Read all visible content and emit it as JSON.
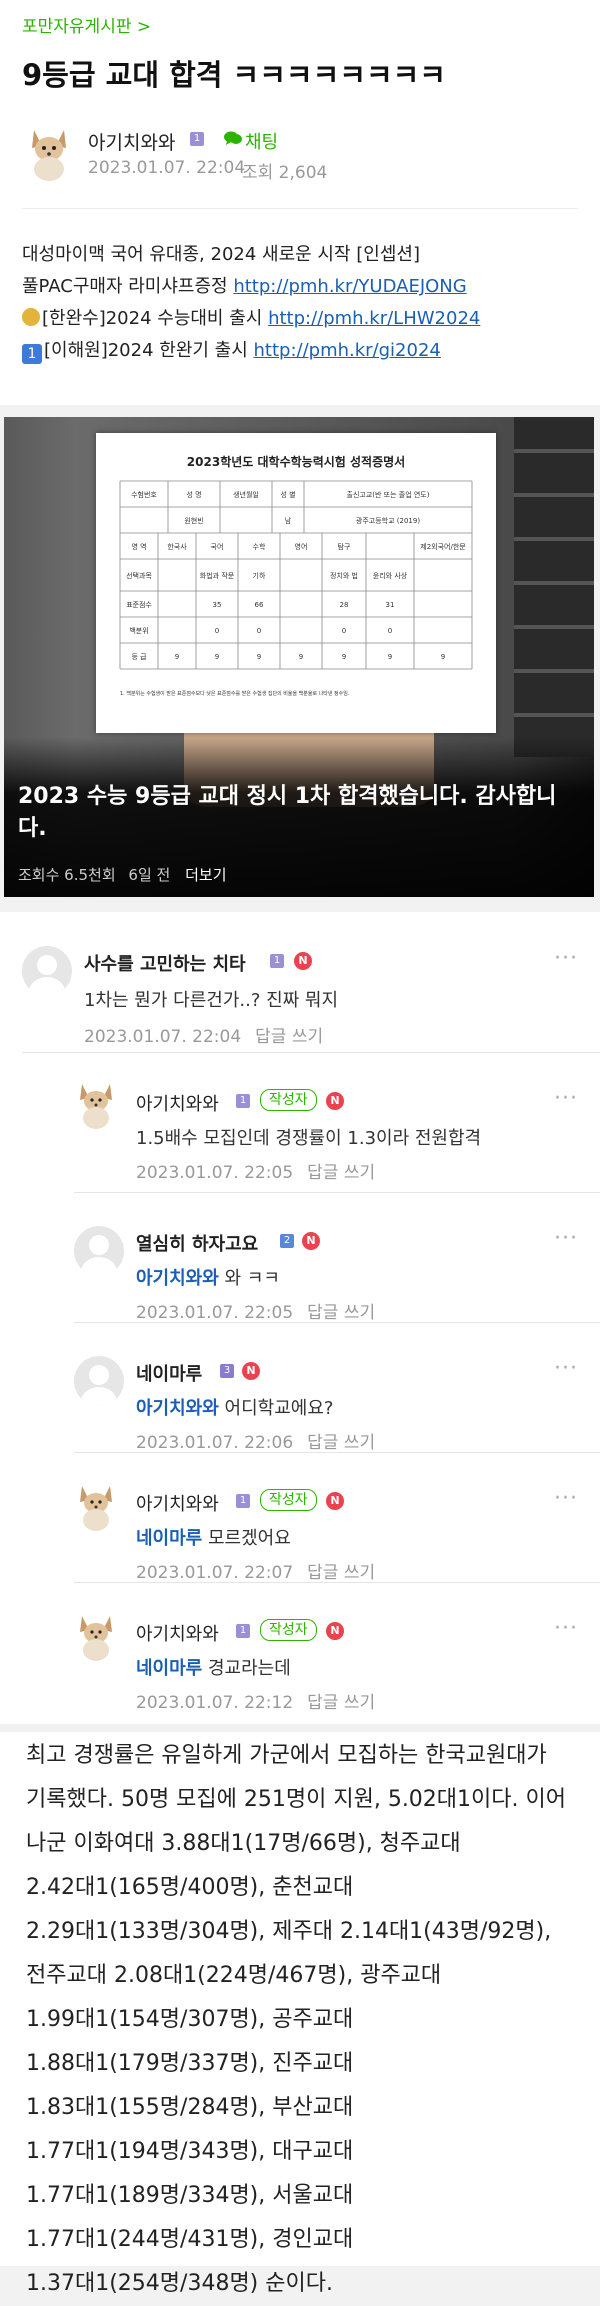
{
  "board": {
    "name": "포만자유게시판 >"
  },
  "post": {
    "title": "9등급 교대 합격 ㅋㅋㅋㅋㅋㅋㅋㅋ",
    "author": "아기치와와",
    "chat_label": "채팅",
    "date": "2023.01.07. 22:04",
    "views_label": "조회 2,604",
    "promo": [
      {
        "text": "대성마이맥 국어 유대종, 2024 새로운 시작 [인셉션]",
        "link": ""
      },
      {
        "text": "풀PAC구매자 라미샤프증정 ",
        "link": "http://pmh.kr/YUDAEJONG"
      },
      {
        "text": "[한완수]2024 수능대비 출시 ",
        "link": "http://pmh.kr/LHW2024"
      },
      {
        "text": "[이해원]2024 한완기 출시 ",
        "link": "http://pmh.kr/gi2024"
      }
    ]
  },
  "video": {
    "title": "2023 수능 9등급 교대 정시 1차 합격했습니다. 감사합니다.",
    "views": "조회수 6.5천회",
    "age": "6일 전",
    "more": "더보기",
    "certificate": {
      "title": "2023학년도 대학수학능력시험 성적증명서",
      "header": [
        "수험번호",
        "성 명",
        "생년월일",
        "성 별",
        "출신고교(반 또는 졸업 연도)"
      ],
      "info": [
        "",
        "원현빈",
        "",
        "남",
        "광주고등학교 (2019)"
      ],
      "subjects": [
        "영 역",
        "한국사",
        "국어",
        "수학",
        "영어",
        "탐구",
        "",
        "제2외국어/한문"
      ],
      "choice": [
        "선택과목",
        "",
        "화법과 작문",
        "기하",
        "",
        "정치와 법",
        "윤리와 사상",
        ""
      ],
      "standard": [
        "표준점수",
        "",
        "35",
        "66",
        "",
        "28",
        "31",
        ""
      ],
      "percentile": [
        "백분위",
        "",
        "0",
        "0",
        "",
        "0",
        "0",
        ""
      ],
      "grade": [
        "등 급",
        "9",
        "9",
        "9",
        "9",
        "9",
        "9",
        "9"
      ],
      "footnote": "1. 백분위는 수험생이 받은 표준점수보다 낮은 표준점수를 받은 수험생 집단의 비율을 백분율로 나타낸 정수임."
    }
  },
  "comments": [
    {
      "author": "사수를 고민하는 치타",
      "level": "1",
      "mention": "",
      "text": "1차는 뭔가 다른건가..? 진짜 뭐지",
      "date": "2023.01.07. 22:04",
      "reply": "답글 쓰기",
      "is_writer": false,
      "nested": false
    },
    {
      "author": "아기치와와",
      "level": "1",
      "mention": "",
      "text": "1.5배수 모집인데 경쟁률이 1.3이라 전원합격",
      "date": "2023.01.07. 22:05",
      "reply": "답글 쓰기",
      "is_writer": true,
      "nested": true
    },
    {
      "author": "열심히 하자고요",
      "level": "2",
      "mention": "아기치와와",
      "text": " 와 ㅋㅋ",
      "date": "2023.01.07. 22:05",
      "reply": "답글 쓰기",
      "is_writer": false,
      "nested": true
    },
    {
      "author": "네이마루",
      "level": "3",
      "mention": "아기치와와",
      "text": " 어디학교에요?",
      "date": "2023.01.07. 22:06",
      "reply": "답글 쓰기",
      "is_writer": false,
      "nested": true
    },
    {
      "author": "아기치와와",
      "level": "1",
      "mention": "네이마루",
      "text": " 모르겠어요",
      "date": "2023.01.07. 22:07",
      "reply": "답글 쓰기",
      "is_writer": true,
      "nested": true
    },
    {
      "author": "아기치와와",
      "level": "1",
      "mention": "네이마루",
      "text": " 경교라는데",
      "date": "2023.01.07. 22:12",
      "reply": "답글 쓰기",
      "is_writer": true,
      "nested": true
    }
  ],
  "writer_tag": "작성자",
  "n_badge": "N",
  "more_dots": "···",
  "article": {
    "text": "최고 경쟁률은 유일하게 가군에서 모집하는 한국교원대가 기록했다. 50명 모집에 251명이 지원, 5.02대1이다. 이어 나군 이화여대 3.88대1(17명/66명), 청주교대 2.42대1(165명/400명), 춘천교대 2.29대1(133명/304명), 제주대 2.14대1(43명/92명), 전주교대 2.08대1(224명/467명), 광주교대 1.99대1(154명/307명), 공주교대 1.88대1(179명/337명), 진주교대 1.83대1(155명/284명), 부산교대 1.77대1(194명/343명), 대구교대 1.77대1(189명/334명), 서울교대 1.77대1(244명/431명), 경인교대 1.37대1(254명/348명) 순이다."
  },
  "colors": {
    "board": "#2db400",
    "link": "#1a5fb4",
    "mention": "#1a5fb4",
    "badge": "#e8434f"
  }
}
